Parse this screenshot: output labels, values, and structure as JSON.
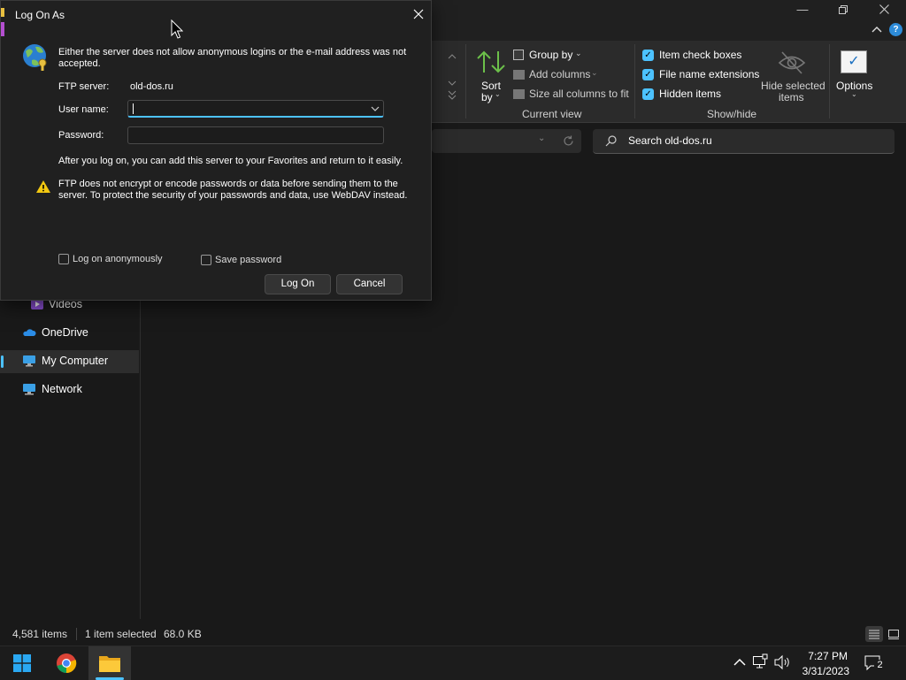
{
  "dialog": {
    "title": "Log On As",
    "message": "Either the server does not allow anonymous logins or the e-mail address was not accepted.",
    "ftp_server_label": "FTP server:",
    "ftp_server_value": "old-dos.ru",
    "username_label": "User name:",
    "username_value": "",
    "password_label": "Password:",
    "password_value": "",
    "info_text": "After you log on, you can add this server to your Favorites and return to it easily.",
    "warning_text": "FTP does not encrypt or encode passwords or data before sending them to the server.  To protect the security of your passwords and data, use WebDAV instead.",
    "anon_checkbox_label": "Log on anonymously",
    "save_password_label": "Save password",
    "logon_button": "Log On",
    "cancel_button": "Cancel"
  },
  "ribbon": {
    "sort_label_1": "Sort",
    "sort_label_2": "by",
    "group_by": "Group by",
    "add_columns": "Add columns",
    "size_columns": "Size all columns to fit",
    "current_view_label": "Current view",
    "item_check_boxes": "Item check boxes",
    "file_name_extensions": "File name extensions",
    "hidden_items": "Hidden items",
    "hide_selected_1": "Hide selected",
    "hide_selected_2": "items",
    "show_hide_label": "Show/hide",
    "options": "Options"
  },
  "search": {
    "placeholder": "Search old-dos.ru"
  },
  "nav": {
    "items": [
      {
        "label": "Videos"
      },
      {
        "label": "OneDrive"
      },
      {
        "label": "My Computer"
      },
      {
        "label": "Network"
      }
    ]
  },
  "status": {
    "count": "4,581 items",
    "selected": "1 item selected",
    "size": "68.0 KB"
  },
  "taskbar": {
    "time": "7:27 PM",
    "date": "3/31/2023",
    "notification_count": "2"
  },
  "colors": {
    "accent": "#4cc2ff",
    "background": "#191919",
    "dialog_bg": "#202020",
    "warning": "#f2c811"
  }
}
